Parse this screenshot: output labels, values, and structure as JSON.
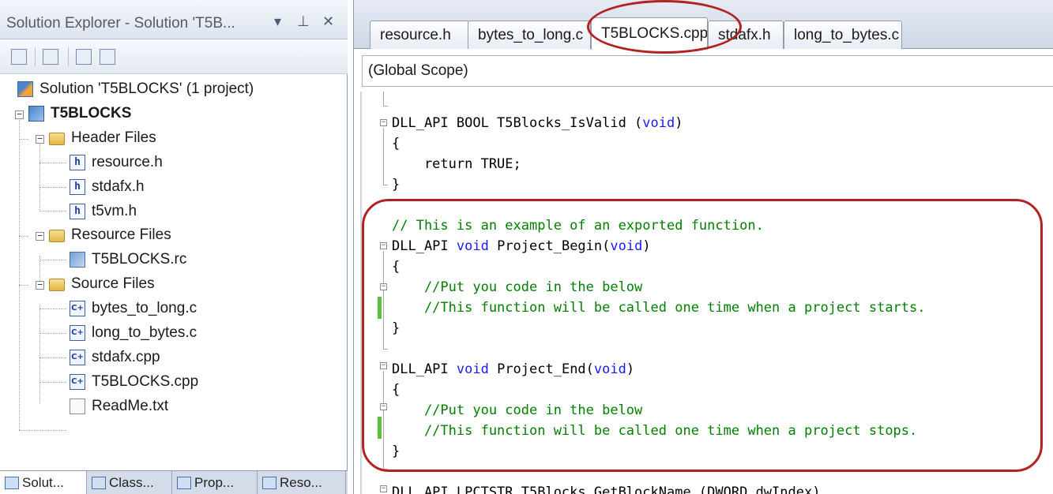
{
  "solution_explorer": {
    "title": "Solution Explorer - Solution 'T5B...",
    "title_buttons": [
      "▾",
      "⊥",
      "✕"
    ],
    "tree": [
      {
        "label": "Solution 'T5BLOCKS' (1 project)",
        "icon": "solution-icon",
        "bold": false
      },
      {
        "label": "T5BLOCKS",
        "icon": "project-icon",
        "bold": true
      },
      {
        "label": "Header Files",
        "icon": "folder-icon"
      },
      {
        "label": "resource.h",
        "icon": "header-file-icon"
      },
      {
        "label": "stdafx.h",
        "icon": "header-file-icon"
      },
      {
        "label": "t5vm.h",
        "icon": "header-file-icon"
      },
      {
        "label": "Resource Files",
        "icon": "folder-icon"
      },
      {
        "label": "T5BLOCKS.rc",
        "icon": "resource-file-icon"
      },
      {
        "label": "Source Files",
        "icon": "folder-icon"
      },
      {
        "label": "bytes_to_long.c",
        "icon": "cpp-file-icon"
      },
      {
        "label": "long_to_bytes.c",
        "icon": "cpp-file-icon"
      },
      {
        "label": "stdafx.cpp",
        "icon": "cpp-file-icon"
      },
      {
        "label": "T5BLOCKS.cpp",
        "icon": "cpp-file-icon"
      },
      {
        "label": "ReadMe.txt",
        "icon": "text-file-icon"
      }
    ],
    "bottom_tabs": [
      "Solut...",
      "Class...",
      "Prop...",
      "Reso..."
    ]
  },
  "editor": {
    "tabs": [
      "resource.h",
      "bytes_to_long.c",
      "T5BLOCKS.cpp",
      "stdafx.h",
      "long_to_bytes.c"
    ],
    "active_tab": "T5BLOCKS.cpp",
    "scope": "(Global Scope)",
    "code": {
      "l1_pre": "DLL_API BOOL T5Blocks_IsValid (",
      "l1_kw": "void",
      "l1_post": ")",
      "l2": "{",
      "l3": "    return TRUE;",
      "l4": "}",
      "l5": "// This is an example of an exported function.",
      "l6_pre": "DLL_API ",
      "l6_kw": "void",
      "l6_mid": " Project_Begin(",
      "l6_kw2": "void",
      "l6_post": ")",
      "l7": "{",
      "l8": "    //Put you code in the below",
      "l9": "    //This function will be called one time when a project starts.",
      "l10": "}",
      "l11_pre": "DLL_API ",
      "l11_kw": "void",
      "l11_mid": " Project_End(",
      "l11_kw2": "void",
      "l11_post": ")",
      "l12": "{",
      "l13": "    //Put you code in the below",
      "l14": "    //This function will be called one time when a project stops.",
      "l15": "}",
      "l16": "DLL_API LPCTSTR T5Blocks_GetBlockName (DWORD dwIndex)"
    }
  },
  "colors": {
    "keyword": "#1a1aff",
    "comment": "#008000",
    "annotation": "#b32222"
  }
}
